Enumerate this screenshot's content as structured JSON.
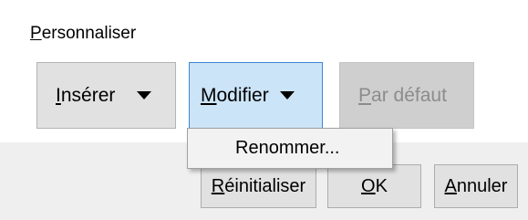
{
  "section": {
    "label_mnemonic": "P",
    "label_rest": "ersonnaliser"
  },
  "toolbar": {
    "insert": {
      "mnemonic": "I",
      "rest": "nsérer",
      "icon": "dropdown-arrow-icon"
    },
    "modify": {
      "mnemonic": "M",
      "rest": "odifier",
      "icon": "dropdown-arrow-icon",
      "state": "pressed"
    },
    "default": {
      "mnemonic": "P",
      "rest": "ar défaut",
      "state": "disabled"
    }
  },
  "menu": {
    "items": [
      {
        "label": "Renommer..."
      }
    ]
  },
  "dialog_buttons": {
    "reset": {
      "mnemonic": "R",
      "rest": "éinitialiser"
    },
    "ok": {
      "mnemonic": "O",
      "rest": "K"
    },
    "cancel": {
      "mnemonic": "A",
      "rest": "nnuler"
    }
  },
  "colors": {
    "pressed_bg": "#cce4f7",
    "pressed_border": "#3b86d4",
    "disabled_text": "#8c8c8c"
  }
}
